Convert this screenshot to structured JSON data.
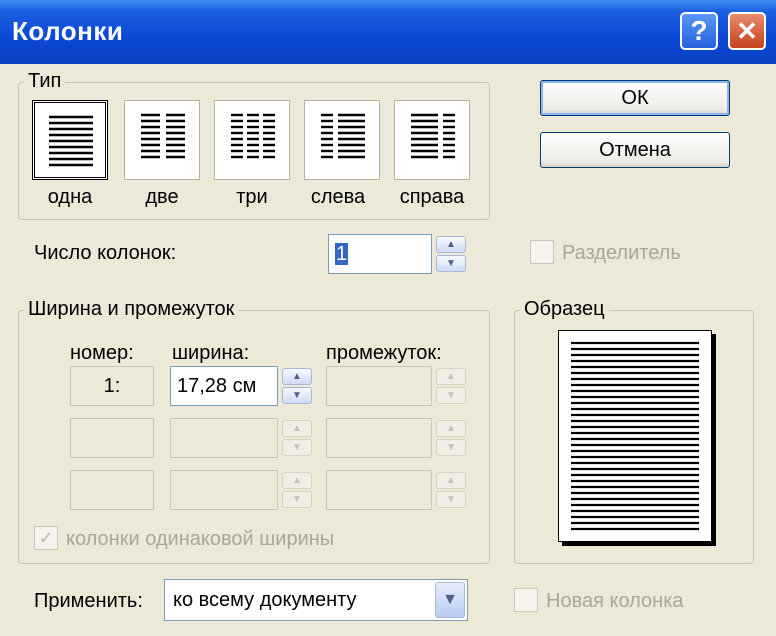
{
  "window": {
    "title": "Колонки",
    "help_glyph": "?",
    "close_glyph": "✕"
  },
  "type_group": {
    "legend": "Тип",
    "presets": [
      {
        "label": "одна",
        "selected": true
      },
      {
        "label": "две",
        "selected": false
      },
      {
        "label": "три",
        "selected": false
      },
      {
        "label": "слева",
        "selected": false
      },
      {
        "label": "справа",
        "selected": false
      }
    ]
  },
  "buttons": {
    "ok": "ОК",
    "cancel": "Отмена"
  },
  "column_count": {
    "label": "Число колонок:",
    "value": "1"
  },
  "separator": {
    "label": "Разделитель",
    "checked": false,
    "enabled": false
  },
  "width_group": {
    "legend": "Ширина и промежуток",
    "headers": {
      "number": "номер:",
      "width": "ширина:",
      "spacing": "промежуток:"
    },
    "rows": [
      {
        "number": "1:",
        "width": "17,28 см",
        "spacing": ""
      },
      {
        "number": "",
        "width": "",
        "spacing": ""
      },
      {
        "number": "",
        "width": "",
        "spacing": ""
      }
    ]
  },
  "equal_width": {
    "label": "колонки одинаковой ширины",
    "checked": true,
    "enabled": false
  },
  "sample": {
    "legend": "Образец"
  },
  "apply": {
    "label": "Применить:",
    "value": "ко всему документу"
  },
  "new_column": {
    "label": "Новая колонка",
    "checked": false,
    "enabled": false
  },
  "icons": {
    "spin_up": "▲",
    "spin_down": "▼",
    "dropdown": "▼",
    "check": "✓"
  }
}
